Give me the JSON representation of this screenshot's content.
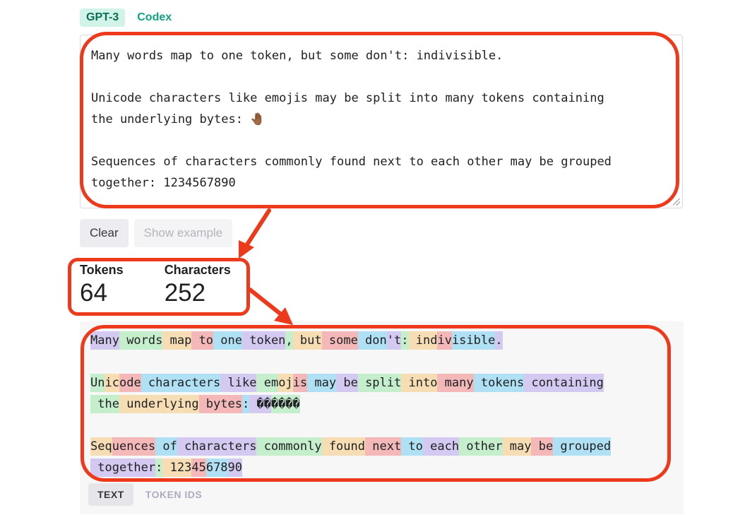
{
  "model_tabs": [
    {
      "label": "GPT-3",
      "active": true
    },
    {
      "label": "Codex",
      "active": false
    }
  ],
  "input": {
    "text": "Many words map to one token, but some don't: indivisible.\n\nUnicode characters like emojis may be split into many tokens containing\nthe underlying bytes: 🤚🏾\n\nSequences of characters commonly found next to each other may be grouped\ntogether: 1234567890"
  },
  "buttons": {
    "clear_label": "Clear",
    "show_example_label": "Show example"
  },
  "stats": {
    "tokens_label": "Tokens",
    "tokens_value": "64",
    "characters_label": "Characters",
    "characters_value": "252"
  },
  "tokens": [
    "Many",
    " words",
    " map",
    " to",
    " one",
    " token",
    ",",
    " but",
    " some",
    " don",
    "'t",
    ":",
    " ind",
    "iv",
    "isible",
    ".",
    "\n\n",
    "Un",
    "ic",
    "ode",
    " characters",
    " like",
    " em",
    "oj",
    "is",
    " may",
    " be",
    " split",
    " into",
    " many",
    " tokens",
    " containing",
    "\n",
    " the",
    " underlying",
    " bytes",
    ":",
    " ��",
    "����",
    "\n\n",
    "Seq",
    "uences",
    " of",
    " characters",
    " commonly",
    " found",
    " next",
    " to",
    " each",
    " other",
    " may",
    " be",
    " grouped",
    "\n",
    " together",
    ":",
    " 123",
    "45",
    "678",
    "90"
  ],
  "view_tabs": [
    {
      "label": "TEXT",
      "active": true
    },
    {
      "label": "TOKEN IDS",
      "active": false
    }
  ],
  "colors": {
    "accent": "#10a37f",
    "annotation": "#ee3a1c"
  }
}
